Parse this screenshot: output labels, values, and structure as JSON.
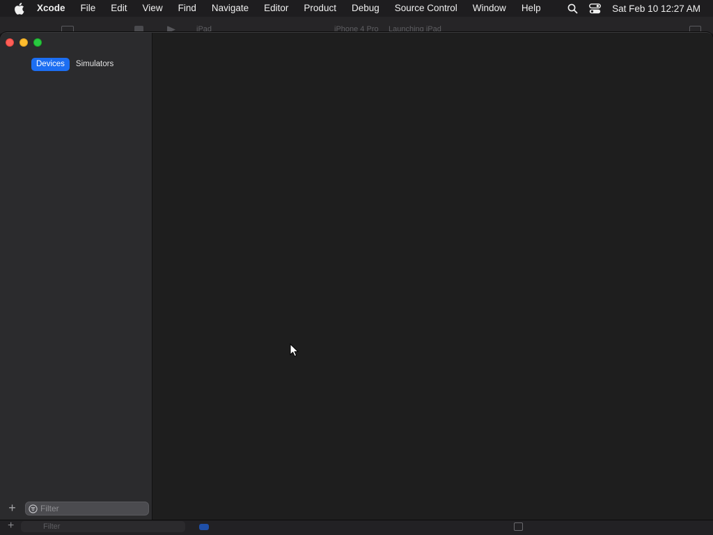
{
  "menubar": {
    "app_name": "Xcode",
    "items": [
      "File",
      "Edit",
      "View",
      "Find",
      "Navigate",
      "Editor",
      "Product",
      "Debug",
      "Source Control",
      "Window",
      "Help"
    ],
    "clock": "Sat Feb 10  12:27 AM",
    "icons": [
      "apple-icon",
      "spotlight-search-icon",
      "control-center-icon"
    ]
  },
  "background_window": {
    "toolbar_ghost_labels": [
      "iPad",
      "iPhone 4 Pro",
      "Launching iPad"
    ],
    "filter_placeholder": "Filter"
  },
  "devices_window": {
    "tabs": [
      {
        "label": "Devices",
        "active": true
      },
      {
        "label": "Simulators",
        "active": false
      }
    ],
    "footer": {
      "add_label": "+",
      "filter_placeholder": "Filter"
    }
  },
  "colors": {
    "accent": "#1c6ef2",
    "close": "#fe5f57",
    "minimize": "#febc2e",
    "zoom": "#28c840"
  }
}
